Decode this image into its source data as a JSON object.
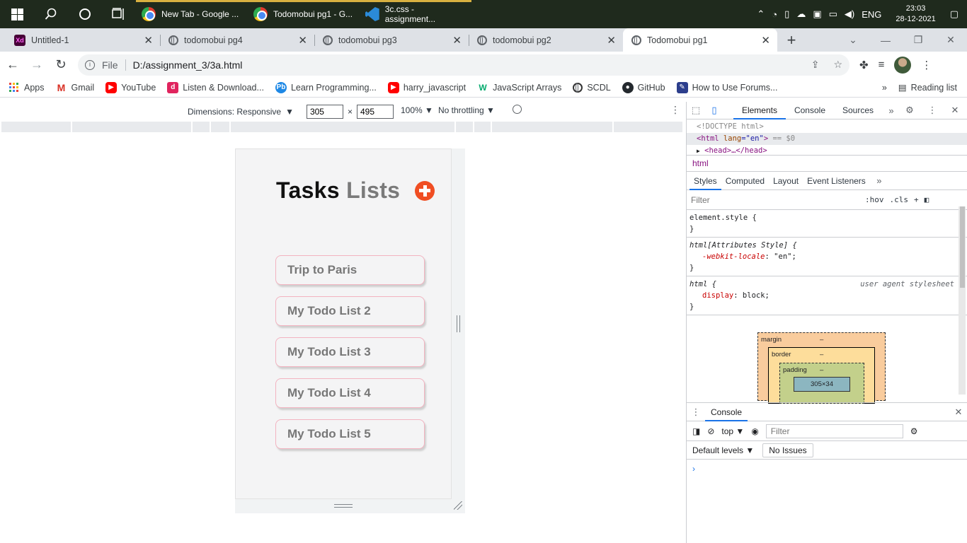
{
  "taskbar": {
    "apps": [
      {
        "label": "New Tab - Google ...",
        "active": true
      },
      {
        "label": "Todomobui pg1 - G...",
        "active": true
      },
      {
        "label": "3c.css - assignment...",
        "active": true
      }
    ],
    "lang": "ENG",
    "time": "23:03",
    "date": "28-12-2021"
  },
  "tabs": [
    {
      "label": "Untitled-1",
      "icon": "xd-icon",
      "active": false
    },
    {
      "label": "todomobui pg4",
      "icon": "globe-icon",
      "active": false
    },
    {
      "label": "todomobui pg3",
      "icon": "globe-icon",
      "active": false
    },
    {
      "label": "todomobui pg2",
      "icon": "globe-icon",
      "active": false
    },
    {
      "label": "Todomobui pg1",
      "icon": "globe-icon",
      "active": true
    }
  ],
  "address": {
    "scheme_label": "File",
    "url": "D:/assignment_3/3a.html"
  },
  "bookmarks": [
    {
      "label": "Apps",
      "color": "#ea4335"
    },
    {
      "label": "Gmail",
      "color": "#d93025"
    },
    {
      "label": "YouTube",
      "color": "#ff0000"
    },
    {
      "label": "Listen & Download...",
      "color": "#e0245e"
    },
    {
      "label": "Learn Programming...",
      "color": "#1e88e5"
    },
    {
      "label": "harry_javascript",
      "color": "#ff0000"
    },
    {
      "label": "JavaScript Arrays",
      "color": "#04aa6d"
    },
    {
      "label": "SCDL",
      "color": "#333333"
    },
    {
      "label": "GitHub",
      "color": "#24292e"
    },
    {
      "label": "How to Use Forums...",
      "color": "#2c3e8c"
    }
  ],
  "reading_list": "Reading list",
  "device_toolbar": {
    "dimensions_label": "Dimensions: Responsive",
    "width": "305",
    "height": "495",
    "times": "×",
    "zoom": "100%",
    "throttle": "No throttling"
  },
  "app": {
    "title_word1": "Tasks",
    "title_word2": "Lists",
    "lists": [
      "Trip to Paris",
      "My Todo List 2",
      "My Todo List 3",
      "My Todo List 4",
      "My Todo List 5"
    ]
  },
  "devtools": {
    "tabs": [
      "Elements",
      "Console",
      "Sources"
    ],
    "dom": {
      "doctype": "<!DOCTYPE html>",
      "html_open": "<html",
      "html_attr": " lang",
      "html_val": "=\"en\"",
      "html_close": ">",
      "eq_sel": " == $0",
      "head": "<head>…</head>"
    },
    "breadcrumb": "html",
    "style_tabs": [
      "Styles",
      "Computed",
      "Layout",
      "Event Listeners"
    ],
    "filter_placeholder": "Filter",
    "hov": ":hov",
    "cls": ".cls",
    "rules": {
      "r1_sel": "element.style {",
      "r2_sel": "html[Attributes Style] {",
      "r2_prop": "-webkit-locale",
      "r2_val": "\"en\"",
      "r3_sel": "html {",
      "r3_src": "user agent stylesheet",
      "r3_prop": "display",
      "r3_val": "block",
      "close": "}"
    },
    "box": {
      "margin": "margin",
      "border": "border",
      "padding": "padding",
      "content": "305×34",
      "dash": "–"
    },
    "drawer": {
      "title": "Console",
      "context": "top",
      "filter_placeholder": "Filter",
      "levels": "Default levels",
      "issues": "No Issues",
      "prompt": "›"
    }
  }
}
